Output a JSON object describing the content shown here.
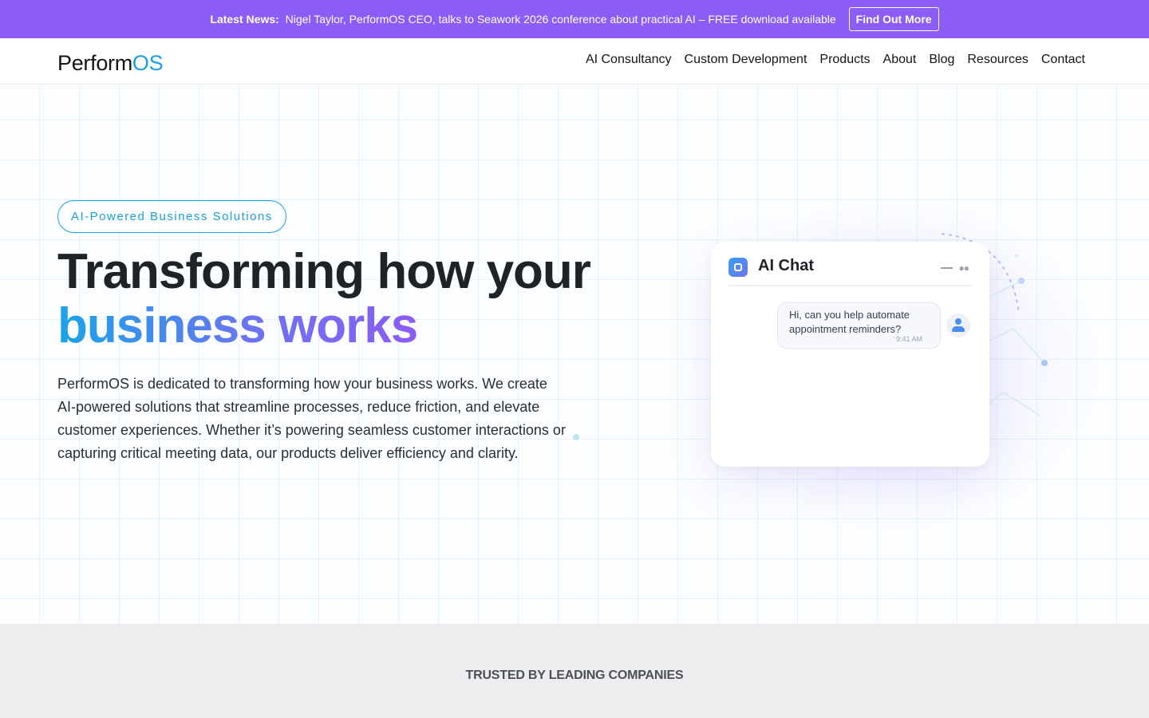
{
  "announcement": {
    "lead": "Latest News:",
    "text": "Nigel Taylor, PerformOS CEO, talks to Seawork 2026 conference about practical AI – FREE download available",
    "button": "Find Out More"
  },
  "header": {
    "logo_part1": "Perform",
    "logo_part2": "OS",
    "nav": [
      "AI Consultancy",
      "Custom Development",
      "Products",
      "About",
      "Blog",
      "Resources",
      "Contact"
    ]
  },
  "hero": {
    "pill": "AI-Powered Business Solutions",
    "title_line1": "Transforming how your",
    "title_line2": "business works",
    "description": "PerformOS is dedicated to transforming how your business works. We create AI-powered solutions that streamline processes, reduce friction, and elevate customer experiences. Whether it’s powering seamless customer interactions or capturing critical meeting data, our products deliver efficiency and clarity."
  },
  "chat": {
    "title": "AI Chat",
    "message": "Hi, can you help automate appointment reminders?",
    "time": "9:41 AM",
    "icons": [
      "bot-icon",
      "minimize-icon",
      "more-icon",
      "user-avatar-icon"
    ]
  },
  "trusted": {
    "label": "TRUSTED BY LEADING COMPANIES"
  },
  "colors": {
    "announcement_bg": "#8b5cf6",
    "brand_blue": "#1aa0e6",
    "gradient_end": "#8b5cf6",
    "trusted_bg": "#ededef"
  }
}
